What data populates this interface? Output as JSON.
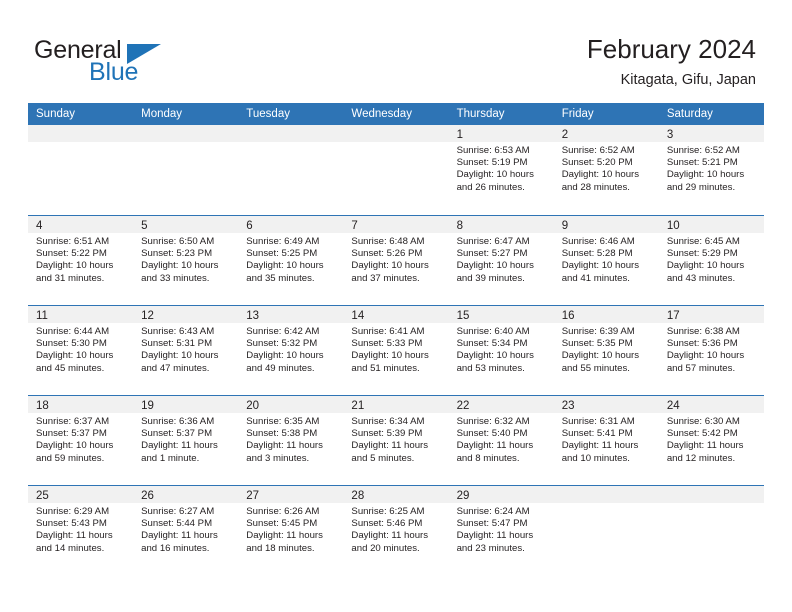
{
  "brand": {
    "name_top": "General",
    "name_bottom": "Blue",
    "accent_color": "#1f73b7"
  },
  "header": {
    "title": "February 2024",
    "subtitle": "Kitagata, Gifu, Japan"
  },
  "calendar": {
    "header_bg": "#2e74b5",
    "day_band_bg": "#f1f1f1",
    "weekdays": [
      "Sunday",
      "Monday",
      "Tuesday",
      "Wednesday",
      "Thursday",
      "Friday",
      "Saturday"
    ],
    "weeks": [
      [
        {
          "day": "",
          "sunrise": "",
          "sunset": "",
          "daylight": ""
        },
        {
          "day": "",
          "sunrise": "",
          "sunset": "",
          "daylight": ""
        },
        {
          "day": "",
          "sunrise": "",
          "sunset": "",
          "daylight": ""
        },
        {
          "day": "",
          "sunrise": "",
          "sunset": "",
          "daylight": ""
        },
        {
          "day": "1",
          "sunrise": "Sunrise: 6:53 AM",
          "sunset": "Sunset: 5:19 PM",
          "daylight": "Daylight: 10 hours and 26 minutes."
        },
        {
          "day": "2",
          "sunrise": "Sunrise: 6:52 AM",
          "sunset": "Sunset: 5:20 PM",
          "daylight": "Daylight: 10 hours and 28 minutes."
        },
        {
          "day": "3",
          "sunrise": "Sunrise: 6:52 AM",
          "sunset": "Sunset: 5:21 PM",
          "daylight": "Daylight: 10 hours and 29 minutes."
        }
      ],
      [
        {
          "day": "4",
          "sunrise": "Sunrise: 6:51 AM",
          "sunset": "Sunset: 5:22 PM",
          "daylight": "Daylight: 10 hours and 31 minutes."
        },
        {
          "day": "5",
          "sunrise": "Sunrise: 6:50 AM",
          "sunset": "Sunset: 5:23 PM",
          "daylight": "Daylight: 10 hours and 33 minutes."
        },
        {
          "day": "6",
          "sunrise": "Sunrise: 6:49 AM",
          "sunset": "Sunset: 5:25 PM",
          "daylight": "Daylight: 10 hours and 35 minutes."
        },
        {
          "day": "7",
          "sunrise": "Sunrise: 6:48 AM",
          "sunset": "Sunset: 5:26 PM",
          "daylight": "Daylight: 10 hours and 37 minutes."
        },
        {
          "day": "8",
          "sunrise": "Sunrise: 6:47 AM",
          "sunset": "Sunset: 5:27 PM",
          "daylight": "Daylight: 10 hours and 39 minutes."
        },
        {
          "day": "9",
          "sunrise": "Sunrise: 6:46 AM",
          "sunset": "Sunset: 5:28 PM",
          "daylight": "Daylight: 10 hours and 41 minutes."
        },
        {
          "day": "10",
          "sunrise": "Sunrise: 6:45 AM",
          "sunset": "Sunset: 5:29 PM",
          "daylight": "Daylight: 10 hours and 43 minutes."
        }
      ],
      [
        {
          "day": "11",
          "sunrise": "Sunrise: 6:44 AM",
          "sunset": "Sunset: 5:30 PM",
          "daylight": "Daylight: 10 hours and 45 minutes."
        },
        {
          "day": "12",
          "sunrise": "Sunrise: 6:43 AM",
          "sunset": "Sunset: 5:31 PM",
          "daylight": "Daylight: 10 hours and 47 minutes."
        },
        {
          "day": "13",
          "sunrise": "Sunrise: 6:42 AM",
          "sunset": "Sunset: 5:32 PM",
          "daylight": "Daylight: 10 hours and 49 minutes."
        },
        {
          "day": "14",
          "sunrise": "Sunrise: 6:41 AM",
          "sunset": "Sunset: 5:33 PM",
          "daylight": "Daylight: 10 hours and 51 minutes."
        },
        {
          "day": "15",
          "sunrise": "Sunrise: 6:40 AM",
          "sunset": "Sunset: 5:34 PM",
          "daylight": "Daylight: 10 hours and 53 minutes."
        },
        {
          "day": "16",
          "sunrise": "Sunrise: 6:39 AM",
          "sunset": "Sunset: 5:35 PM",
          "daylight": "Daylight: 10 hours and 55 minutes."
        },
        {
          "day": "17",
          "sunrise": "Sunrise: 6:38 AM",
          "sunset": "Sunset: 5:36 PM",
          "daylight": "Daylight: 10 hours and 57 minutes."
        }
      ],
      [
        {
          "day": "18",
          "sunrise": "Sunrise: 6:37 AM",
          "sunset": "Sunset: 5:37 PM",
          "daylight": "Daylight: 10 hours and 59 minutes."
        },
        {
          "day": "19",
          "sunrise": "Sunrise: 6:36 AM",
          "sunset": "Sunset: 5:37 PM",
          "daylight": "Daylight: 11 hours and 1 minute."
        },
        {
          "day": "20",
          "sunrise": "Sunrise: 6:35 AM",
          "sunset": "Sunset: 5:38 PM",
          "daylight": "Daylight: 11 hours and 3 minutes."
        },
        {
          "day": "21",
          "sunrise": "Sunrise: 6:34 AM",
          "sunset": "Sunset: 5:39 PM",
          "daylight": "Daylight: 11 hours and 5 minutes."
        },
        {
          "day": "22",
          "sunrise": "Sunrise: 6:32 AM",
          "sunset": "Sunset: 5:40 PM",
          "daylight": "Daylight: 11 hours and 8 minutes."
        },
        {
          "day": "23",
          "sunrise": "Sunrise: 6:31 AM",
          "sunset": "Sunset: 5:41 PM",
          "daylight": "Daylight: 11 hours and 10 minutes."
        },
        {
          "day": "24",
          "sunrise": "Sunrise: 6:30 AM",
          "sunset": "Sunset: 5:42 PM",
          "daylight": "Daylight: 11 hours and 12 minutes."
        }
      ],
      [
        {
          "day": "25",
          "sunrise": "Sunrise: 6:29 AM",
          "sunset": "Sunset: 5:43 PM",
          "daylight": "Daylight: 11 hours and 14 minutes."
        },
        {
          "day": "26",
          "sunrise": "Sunrise: 6:27 AM",
          "sunset": "Sunset: 5:44 PM",
          "daylight": "Daylight: 11 hours and 16 minutes."
        },
        {
          "day": "27",
          "sunrise": "Sunrise: 6:26 AM",
          "sunset": "Sunset: 5:45 PM",
          "daylight": "Daylight: 11 hours and 18 minutes."
        },
        {
          "day": "28",
          "sunrise": "Sunrise: 6:25 AM",
          "sunset": "Sunset: 5:46 PM",
          "daylight": "Daylight: 11 hours and 20 minutes."
        },
        {
          "day": "29",
          "sunrise": "Sunrise: 6:24 AM",
          "sunset": "Sunset: 5:47 PM",
          "daylight": "Daylight: 11 hours and 23 minutes."
        },
        {
          "day": "",
          "sunrise": "",
          "sunset": "",
          "daylight": ""
        },
        {
          "day": "",
          "sunrise": "",
          "sunset": "",
          "daylight": ""
        }
      ]
    ]
  }
}
